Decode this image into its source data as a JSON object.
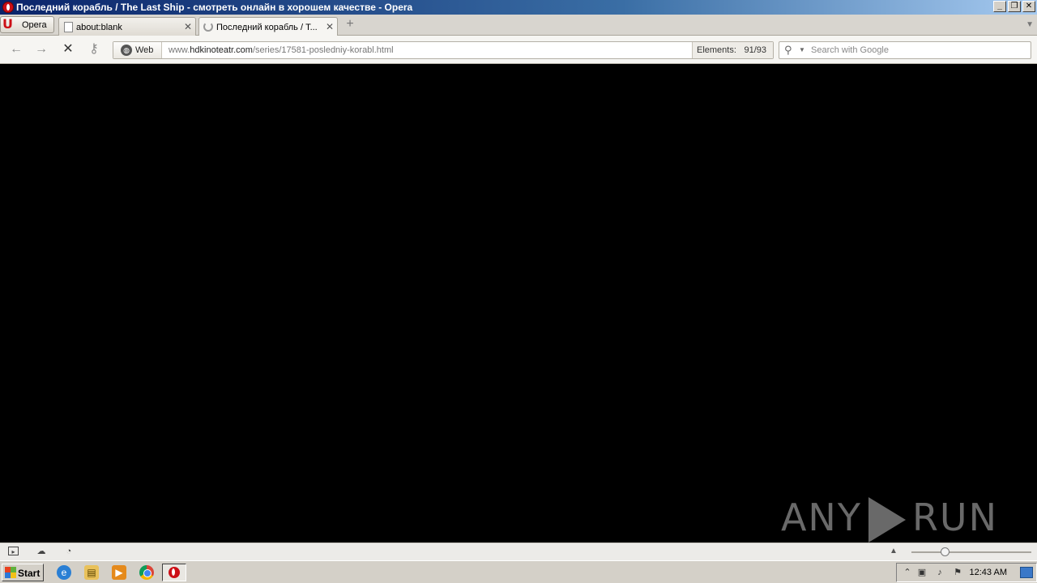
{
  "window": {
    "title": "Последний корабль / The Last Ship - смотреть онлайн в хорошем качестве - Opera",
    "min_label": "_",
    "max_label": "❐",
    "close_label": "✕"
  },
  "tabs": {
    "menu_label": "Opera",
    "items": [
      {
        "label": "about:blank",
        "close": "✕"
      },
      {
        "label": "Последний корабль / T...",
        "close": "✕"
      }
    ],
    "new_tab": "+",
    "dropdown": "▼"
  },
  "nav": {
    "back": "←",
    "forward": "→",
    "stop": "✕",
    "key": "⚷"
  },
  "address": {
    "badge": "Web",
    "url_prefix": "www.",
    "url_domain": "hdkinoteatr.com",
    "url_path": "/series/17581-posledniy-korabl.html",
    "elements_label": "Elements:",
    "elements_count": "91/93"
  },
  "search": {
    "placeholder": "Search with Google"
  },
  "watermark": {
    "left": "ANY",
    "right": "RUN"
  },
  "statusbar": {
    "panel_icon": "panel-toggle-icon",
    "cloud_icon": "cloud-icon",
    "speed_icon": "speed-dial-icon",
    "zoom_arrow": "▲",
    "zoom_fraction": 0.28
  },
  "taskbar": {
    "start_label": "Start",
    "clock": "12:43 AM"
  },
  "colors": {
    "opera_red": "#cc0f16",
    "titlebar_blue": "#0a246a",
    "content_bg": "#000000"
  }
}
